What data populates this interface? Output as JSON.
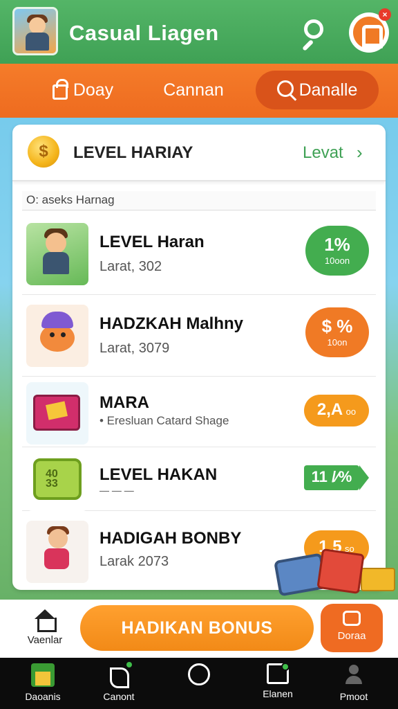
{
  "header": {
    "title": "Casual Liagen",
    "notification_badge": "×",
    "brand_color": "#4caf5f"
  },
  "tabs": [
    {
      "label": "Doay",
      "icon": "lock-icon"
    },
    {
      "label": "Cannan",
      "icon": ""
    },
    {
      "label": "Danalle",
      "icon": "search-icon",
      "active": true
    }
  ],
  "card": {
    "title": "LEVEL HARIAY",
    "coin_symbol": "$",
    "link_label": "Levat",
    "link_chevron": "›",
    "subheader": "O: aseks Harnag"
  },
  "items": [
    {
      "title": "LEVEL Haran",
      "subtitle": "Larat, 302",
      "reward_big": "1%",
      "reward_small": "10oon",
      "reward_color": "#43ad4f",
      "reward_shape": "circle"
    },
    {
      "title": "HADZKAH Malhny",
      "subtitle": "Larat, 3079",
      "reward_big": "$ %",
      "reward_small": "10on",
      "reward_color": "#f07a25",
      "reward_shape": "circle"
    },
    {
      "title": "MARA",
      "subtitle": "• Eresluan Catard Shage",
      "reward_big": "2,A",
      "reward_small": "oo",
      "reward_color": "#f59a1c",
      "reward_shape": "pill"
    },
    {
      "title": "LEVEL HAKAN",
      "subtitle": "— — —",
      "reward_big": "11 /⁄%",
      "reward_small": "",
      "reward_color": "#43ad4f",
      "reward_shape": "tag"
    },
    {
      "title": "HADIGAH BONBY",
      "subtitle": "Larak 2073",
      "reward_big": "1,5",
      "reward_small": "so",
      "reward_color": "#f59a1c",
      "reward_shape": "pill"
    }
  ],
  "thumb_numbers": {
    "crate": "40\n33"
  },
  "action_bar": {
    "home_label": "Vaenlar",
    "bonus_label": "HADIKAN BONUS",
    "side_label": "Doraa"
  },
  "nav": [
    {
      "label": "Daoanis",
      "icon": "home-icon"
    },
    {
      "label": "Canont",
      "icon": "note-icon"
    },
    {
      "label": "",
      "icon": "circle-icon"
    },
    {
      "label": "Elanen",
      "icon": "box-icon"
    },
    {
      "label": "Pmoot",
      "icon": "profile-icon"
    }
  ]
}
